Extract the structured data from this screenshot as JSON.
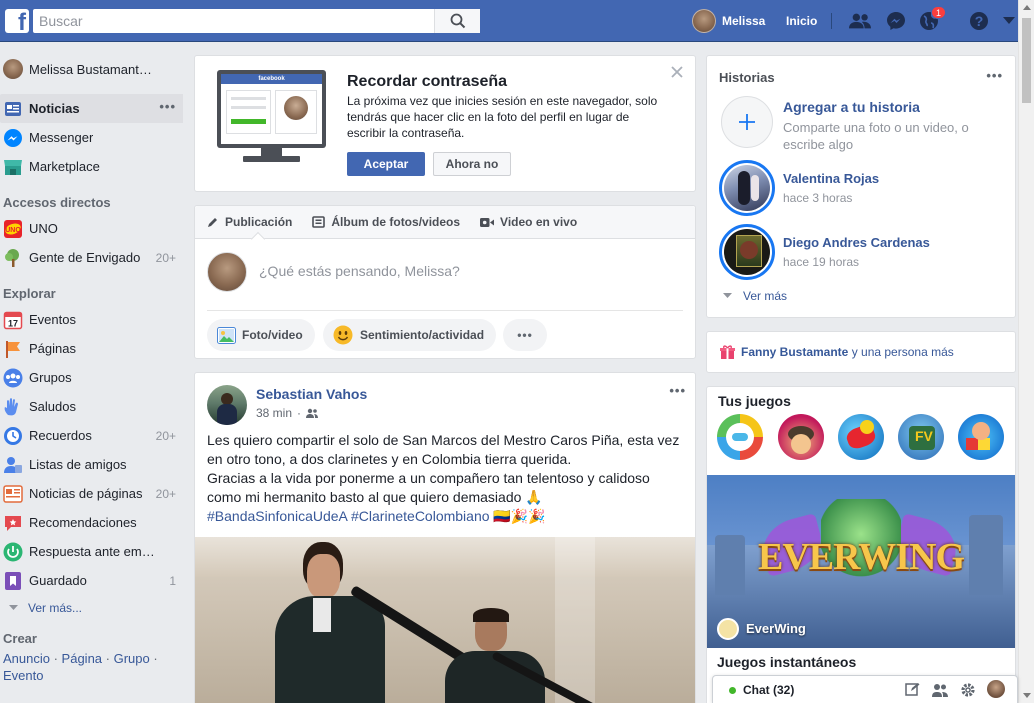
{
  "topbar": {
    "logo": "f",
    "search_placeholder": "Buscar",
    "user_name": "Melissa",
    "home": "Inicio",
    "notifications_count": "1"
  },
  "sidebar": {
    "profile_name": "Melissa Bustamant…",
    "main_items": [
      {
        "label": "Noticias",
        "icon": "news-feed-icon"
      },
      {
        "label": "Messenger",
        "icon": "messenger-icon"
      },
      {
        "label": "Marketplace",
        "icon": "marketplace-icon"
      }
    ],
    "shortcuts_title": "Accesos directos",
    "shortcuts": [
      {
        "label": "UNO",
        "count": ""
      },
      {
        "label": "Gente de Envigado",
        "count": "20+"
      }
    ],
    "explore_title": "Explorar",
    "explore": [
      {
        "label": "Eventos",
        "count": ""
      },
      {
        "label": "Páginas",
        "count": ""
      },
      {
        "label": "Grupos",
        "count": ""
      },
      {
        "label": "Saludos",
        "count": ""
      },
      {
        "label": "Recuerdos",
        "count": "20+"
      },
      {
        "label": "Listas de amigos",
        "count": ""
      },
      {
        "label": "Noticias de páginas",
        "count": "20+"
      },
      {
        "label": "Recomendaciones",
        "count": ""
      },
      {
        "label": "Respuesta ante em…",
        "count": ""
      },
      {
        "label": "Guardado",
        "count": "1"
      }
    ],
    "see_more": "Ver más...",
    "create_title": "Crear",
    "create_links": [
      "Anuncio",
      "Página",
      "Grupo",
      "Evento"
    ]
  },
  "remember": {
    "title": "Recordar contraseña",
    "body": "La próxima vez que inicies sesión en este navegador, solo tendrás que hacer clic en la foto del perfil en lugar de escribir la contraseña.",
    "accept": "Aceptar",
    "decline": "Ahora no",
    "illustration_label": "facebook"
  },
  "composer": {
    "tabs": [
      "Publicación",
      "Álbum de fotos/videos",
      "Video en vivo"
    ],
    "placeholder": "¿Qué estás pensando, Melissa?",
    "actions": [
      "Foto/video",
      "Sentimiento/actividad"
    ]
  },
  "post": {
    "author": "Sebastian Vahos",
    "time": "38 min",
    "text_lines": [
      "Les quiero compartir el solo de San Marcos del Mestro Caros Piña, esta vez",
      "en otro tono, a dos clarinetes y en Colombia tierra querida.",
      "Gracias a la vida por ponerme a un compañero tan telentoso y calidoso",
      "como mi hermanito basto al que quiero demasiado 🙏"
    ],
    "hashtags": "#BandaSinfonicaUdeA #ClarineteColombiano",
    "emojis": "🇨🇴🎉🎉"
  },
  "stories": {
    "title": "Historias",
    "add_title": "Agregar a tu historia",
    "add_sub": "Comparte una foto o un video, o escribe algo",
    "items": [
      {
        "name": "Valentina Rojas",
        "time": "hace 3 horas"
      },
      {
        "name": "Diego Andres Cardenas",
        "time": "hace 19 horas"
      }
    ],
    "see_more": "Ver más"
  },
  "birthday": {
    "name": "Fanny Bustamante",
    "rest": " y una persona más"
  },
  "games": {
    "title": "Tus juegos",
    "featured": "EverWing",
    "featured_logo": "EVERWING",
    "instant_title": "Juegos instantáneos"
  },
  "chat": {
    "label": "Chat (32)"
  },
  "colors": {
    "brand": "#4267b2",
    "link": "#385898",
    "background": "#e9ebee"
  }
}
